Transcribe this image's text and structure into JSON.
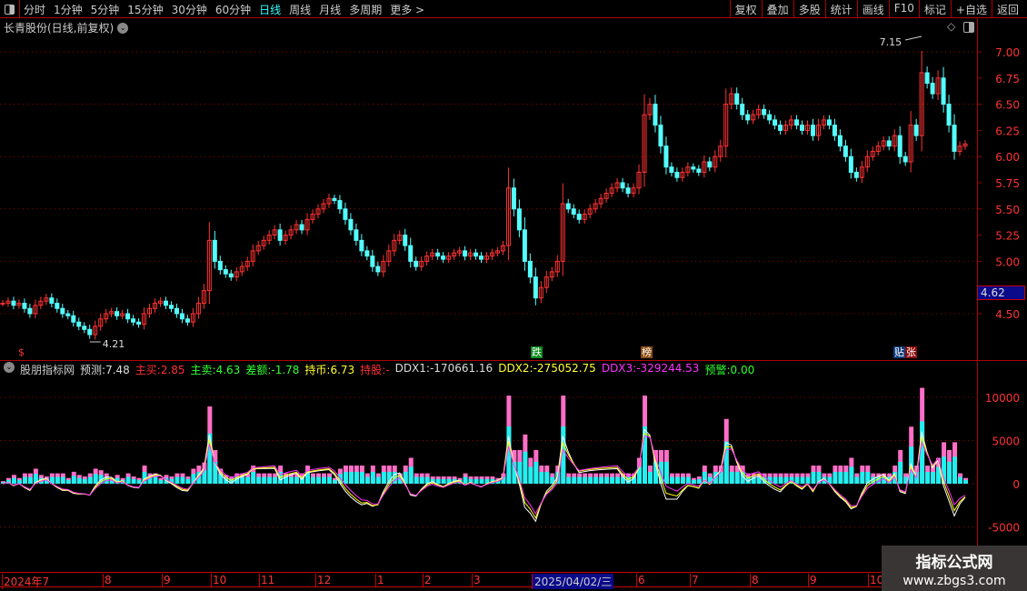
{
  "toolbar": {
    "periods": [
      "分时",
      "1分钟",
      "5分钟",
      "15分钟",
      "30分钟",
      "60分钟",
      "日线",
      "周线",
      "月线",
      "多周期",
      "更多 >"
    ],
    "active": "日线",
    "buttons": [
      "复权",
      "叠加",
      "多股",
      "统计",
      "画线",
      "F10",
      "标记",
      "+自选",
      "返回"
    ]
  },
  "stock": {
    "title": "长青股份(日线,前复权)",
    "current_price": "4.62"
  },
  "annotations": {
    "high": "7.15",
    "low": "4.21"
  },
  "markers": [
    {
      "text": "跌",
      "bg": "#0a8a1a"
    },
    {
      "text": "榜",
      "bg": "#8a4a10"
    },
    {
      "text": "贴",
      "bg": "#0a3a7a"
    },
    {
      "text": "张",
      "bg": "#8a0a0a"
    }
  ],
  "left_marker": "$",
  "indicator": {
    "name": "股朋指标网",
    "items": [
      {
        "label": "预测:",
        "value": "7.48",
        "color": "#dddddd"
      },
      {
        "label": "主买:",
        "value": "2.85",
        "color": "#ff3030"
      },
      {
        "label": "主卖:",
        "value": "4.63",
        "color": "#30ff30"
      },
      {
        "label": "差额:",
        "value": "-1.78",
        "color": "#30ff30"
      },
      {
        "label": "持币:",
        "value": "6.73",
        "color": "#ffff30"
      },
      {
        "label": "持股:",
        "value": "-",
        "color": "#ff3030"
      },
      {
        "label": "DDX1:",
        "value": "-170661.16",
        "color": "#dddddd"
      },
      {
        "label": "DDX2:",
        "value": "-275052.75",
        "color": "#ffff30"
      },
      {
        "label": "DDX3:",
        "value": "-329244.53",
        "color": "#ff30ff"
      },
      {
        "label": "预警:",
        "value": "0.00",
        "color": "#30ff30"
      }
    ]
  },
  "date_axis": {
    "labels": [
      "2024年7",
      "8",
      "9",
      "10",
      "11",
      "12",
      "1",
      "2",
      "3",
      "6",
      "7",
      "8",
      "9",
      "10"
    ],
    "cursor_date": "2025/04/02/三"
  },
  "watermark": {
    "title": "指标公式网",
    "url": "www.zbgs3.com"
  },
  "colors": {
    "up": "#ff3232",
    "down": "#54ffff",
    "grid": "#a00000",
    "axis_text": "#ff3333"
  },
  "chart_data": {
    "type": "candlestick",
    "price_ticks": [
      "7.00",
      "6.75",
      "6.50",
      "6.25",
      "6.00",
      "5.75",
      "5.50",
      "5.25",
      "5.00",
      "4.50"
    ],
    "indicator_ticks": [
      "10000",
      "5000",
      "0",
      "-5000"
    ],
    "closes": [
      4.6,
      4.62,
      4.58,
      4.6,
      4.55,
      4.5,
      4.58,
      4.62,
      4.65,
      4.6,
      4.55,
      4.5,
      4.48,
      4.42,
      4.38,
      4.35,
      4.3,
      4.38,
      4.45,
      4.5,
      4.52,
      4.48,
      4.5,
      4.45,
      4.42,
      4.4,
      4.5,
      4.55,
      4.6,
      4.62,
      4.58,
      4.55,
      4.5,
      4.45,
      4.42,
      4.5,
      4.6,
      4.72,
      5.2,
      5.0,
      4.92,
      4.88,
      4.85,
      4.9,
      4.95,
      5.0,
      5.1,
      5.15,
      5.2,
      5.25,
      5.3,
      5.2,
      5.25,
      5.3,
      5.35,
      5.3,
      5.4,
      5.45,
      5.5,
      5.55,
      5.6,
      5.58,
      5.5,
      5.4,
      5.3,
      5.2,
      5.1,
      5.05,
      4.95,
      4.9,
      5.0,
      5.1,
      5.2,
      5.25,
      5.15,
      5.0,
      4.95,
      5.0,
      5.05,
      5.08,
      5.05,
      5.02,
      5.05,
      5.08,
      5.1,
      5.05,
      5.08,
      5.05,
      5.02,
      5.05,
      5.08,
      5.1,
      5.15,
      5.7,
      5.5,
      5.3,
      5.0,
      4.85,
      4.65,
      4.75,
      4.85,
      4.9,
      5.0,
      5.55,
      5.5,
      5.45,
      5.4,
      5.45,
      5.5,
      5.55,
      5.6,
      5.65,
      5.7,
      5.75,
      5.7,
      5.65,
      5.7,
      5.85,
      6.4,
      6.5,
      6.3,
      6.1,
      5.9,
      5.85,
      5.8,
      5.85,
      5.9,
      5.88,
      5.85,
      5.95,
      5.9,
      6.0,
      6.1,
      6.5,
      6.6,
      6.5,
      6.4,
      6.35,
      6.4,
      6.45,
      6.4,
      6.35,
      6.3,
      6.25,
      6.3,
      6.35,
      6.3,
      6.25,
      6.3,
      6.2,
      6.3,
      6.35,
      6.3,
      6.2,
      6.1,
      6.0,
      5.85,
      5.8,
      5.9,
      6.0,
      6.05,
      6.1,
      6.15,
      6.1,
      6.2,
      6.0,
      5.95,
      6.3,
      6.2,
      6.8,
      6.7,
      6.6,
      6.75,
      6.5,
      6.3,
      6.05,
      6.1,
      6.12
    ]
  }
}
